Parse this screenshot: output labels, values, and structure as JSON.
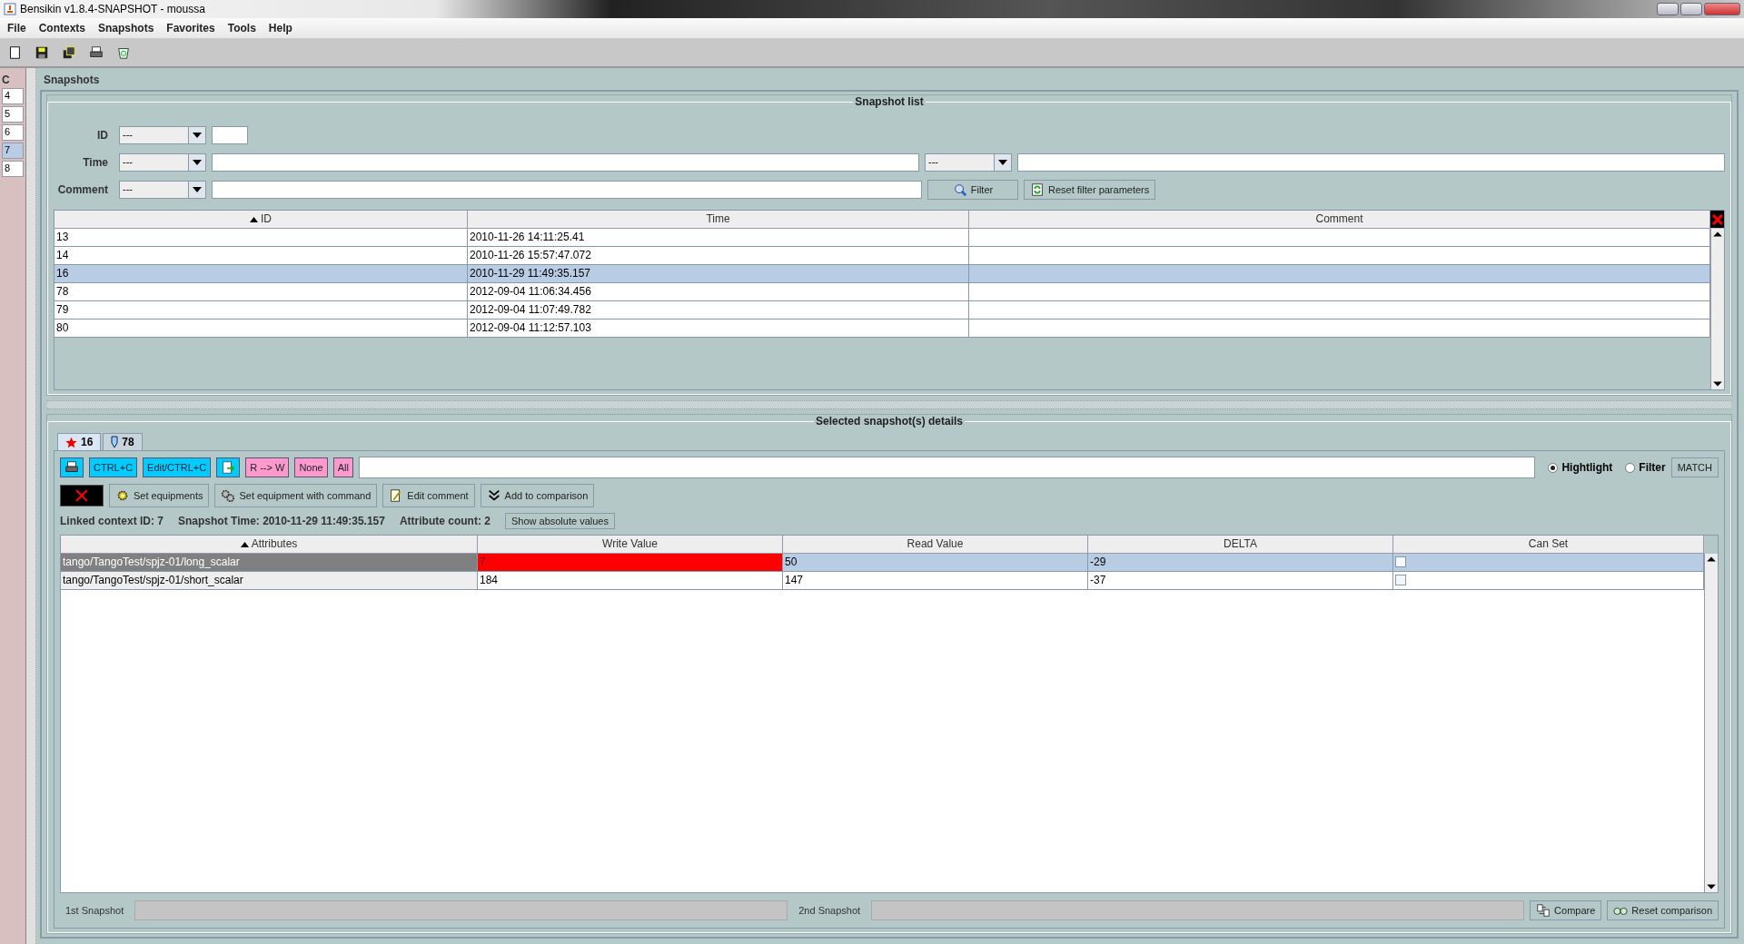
{
  "window": {
    "title": "Bensikin v1.8.4-SNAPSHOT - moussa"
  },
  "menu": [
    "File",
    "Contexts",
    "Snapshots",
    "Favorites",
    "Tools",
    "Help"
  ],
  "toolbar": [
    {
      "kind": "new"
    },
    {
      "kind": "save"
    },
    {
      "kind": "copy"
    },
    {
      "kind": "print"
    },
    {
      "kind": "trash"
    }
  ],
  "left_panel": {
    "title": "C",
    "rows": [
      {
        "label": "4",
        "selected": false
      },
      {
        "label": "5",
        "selected": false
      },
      {
        "label": "6",
        "selected": false
      },
      {
        "label": "7",
        "selected": true
      },
      {
        "label": "8",
        "selected": false
      }
    ]
  },
  "snapshots": {
    "title": "Snapshots",
    "list": {
      "title": "Snapshot list",
      "filters": [
        {
          "kind": "id",
          "label": "ID",
          "operator": "---"
        },
        {
          "kind": "range",
          "label": "Time",
          "operator": "---",
          "operator2": "---"
        },
        {
          "kind": "text",
          "label": "Comment",
          "operator": "---"
        }
      ],
      "filter_button": "Filter",
      "reset_button": "Reset filter parameters",
      "table": {
        "columns": [
          {
            "label": "ID",
            "sorted": true
          },
          {
            "label": "Time",
            "sorted": false
          },
          {
            "label": "Comment",
            "sorted": false
          }
        ],
        "rows": [
          {
            "id": "13",
            "time": "2010-11-26 14:11:25.41",
            "selected": false
          },
          {
            "id": "14",
            "time": "2010-11-26 15:57:47.072",
            "selected": false
          },
          {
            "id": "16",
            "time": "2010-11-29 11:49:35.157",
            "selected": true
          },
          {
            "id": "78",
            "time": "2012-09-04 11:06:34.456",
            "selected": false
          },
          {
            "id": "79",
            "time": "2012-09-04 11:07:49.782",
            "selected": false
          },
          {
            "id": "80",
            "time": "2012-09-04 11:12:57.103",
            "selected": false
          }
        ]
      }
    }
  },
  "details": {
    "title": "Selected snapshot(s) details",
    "tabs": [
      {
        "kind": "star",
        "label": "16",
        "selected": true
      },
      {
        "kind": "pin",
        "label": "78",
        "selected": false
      }
    ],
    "tools": [
      {
        "kind": "print",
        "color": "#00ccff"
      },
      {
        "kind": "text",
        "label": "CTRL+C",
        "color": "#00ccff"
      },
      {
        "kind": "text",
        "label": "Edit/CTRL+C",
        "color": "#00ccff"
      },
      {
        "kind": "export",
        "color": "#00ccff"
      },
      {
        "kind": "text",
        "label": "R --> W",
        "color": "#ff99cc"
      },
      {
        "kind": "text",
        "label": "None",
        "color": "#ff99cc"
      },
      {
        "kind": "text",
        "label": "All",
        "color": "#ff99cc"
      }
    ],
    "modes": [
      {
        "label": "Hightlight",
        "selected": true
      },
      {
        "label": "Filter",
        "selected": false
      }
    ],
    "match_button": "MATCH",
    "actions": [
      {
        "kind": "delete"
      },
      {
        "kind": "gear",
        "label": "Set equipments"
      },
      {
        "kind": "gears",
        "label": "Set equipment with command"
      },
      {
        "kind": "edit",
        "label": "Edit comment"
      },
      {
        "kind": "chevrons",
        "label": "Add to comparison"
      }
    ],
    "info": [
      "Linked context ID: 7",
      "Snapshot Time: 2010-11-29 11:49:35.157",
      "Attribute count: 2"
    ],
    "absolute_button": "Show absolute values",
    "table": {
      "columns": [
        {
          "label": "Attributes",
          "sorted": true
        },
        {
          "label": "Write Value",
          "sorted": false
        },
        {
          "label": "Read Value",
          "sorted": false
        },
        {
          "label": "DELTA",
          "sorted": false
        },
        {
          "label": "Can Set",
          "sorted": false
        }
      ],
      "rows": [
        {
          "attribute": "tango/TangoTest/spjz-01/long_scalar",
          "write": "7",
          "read": "50",
          "delta": "-29",
          "can_set": false,
          "selected": true,
          "alarm": true
        },
        {
          "attribute": "tango/TangoTest/spjz-01/short_scalar",
          "write": "184",
          "read": "147",
          "delta": "-37",
          "can_set": false,
          "selected": false,
          "alarm": false
        }
      ]
    },
    "comparison": {
      "first_label": "1st Snapshot",
      "second_label": "2nd Snapshot",
      "compare_button": "Compare",
      "reset_button": "Reset comparison"
    }
  }
}
